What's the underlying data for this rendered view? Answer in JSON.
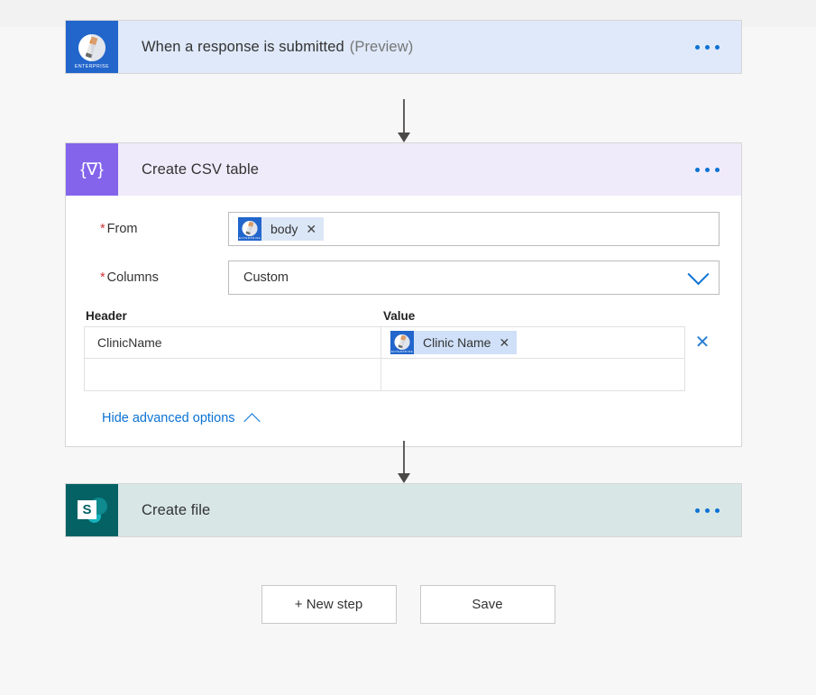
{
  "flow": {
    "trigger": {
      "title": "When a response is submitted",
      "preview_tag": "(Preview)",
      "icon": "microsoft-forms-icon",
      "icon_badge": "ENTERPRISE",
      "menu": "···"
    },
    "csv_action": {
      "title": "Create CSV table",
      "icon": "data-operations-icon",
      "icon_glyph": "{∇}",
      "menu": "···",
      "fields": {
        "from": {
          "label": "From",
          "required_marker": "*",
          "token": {
            "text": "body",
            "remove": "✕",
            "icon": "microsoft-forms-icon",
            "icon_badge": "ENTERPRISE"
          }
        },
        "columns": {
          "label": "Columns",
          "required_marker": "*",
          "value": "Custom",
          "chevron": "chevron-down-icon"
        }
      },
      "kv_table": {
        "header_col_label": "Header",
        "value_col_label": "Value",
        "rows": [
          {
            "header": "ClinicName",
            "value_token": {
              "text": "Clinic Name",
              "remove": "✕",
              "icon": "microsoft-forms-icon",
              "icon_badge": "ENTERPRISE"
            },
            "delete": "✕"
          },
          {
            "header": "",
            "value": ""
          }
        ]
      },
      "advanced_options_link": "Hide advanced options"
    },
    "file_action": {
      "title": "Create file",
      "icon": "sharepoint-icon",
      "icon_letter": "S",
      "menu": "···"
    }
  },
  "footer": {
    "new_step_label": "+ New step",
    "save_label": "Save"
  },
  "colors": {
    "trigger_header": "#dfe9f9",
    "csv_header": "#f0ebfa",
    "file_header": "#d8e6e6",
    "forms_brand": "#2266cc",
    "dataop_brand": "#8364ea",
    "sharepoint_brand": "#046265",
    "accent_link": "#0b72d4",
    "required_star": "#d13438",
    "canvas": "#f7f7f7"
  }
}
